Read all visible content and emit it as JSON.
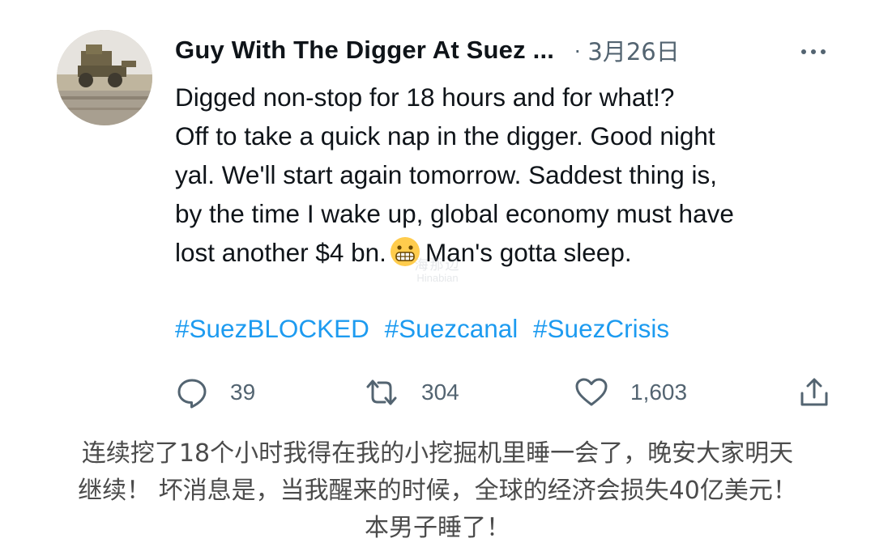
{
  "tweet": {
    "author_name": "Guy With The Digger At Suez ...",
    "separator": "·",
    "date": "3月26日",
    "avatar_icon": "digger-avatar-icon",
    "more_icon": "more-options-icon",
    "body_lines": [
      "Digged non-stop for 18 hours and for what!?",
      "Off to take a quick nap in the digger. Good night",
      "yal. We'll start again tomorrow. Saddest thing is,",
      "by the time I wake up, global economy must have",
      "lost another $4 bn."
    ],
    "emoji_icon": "grimacing-face-emoji",
    "body_tail": "Man's gotta sleep.",
    "hashtags": [
      "#SuezBLOCKED",
      "#Suezcanal",
      "#SuezCrisis"
    ],
    "hashtag_color": "#1d9bf0",
    "actions": {
      "reply": {
        "icon": "reply-icon",
        "count": "39"
      },
      "retweet": {
        "icon": "retweet-icon",
        "count": "304"
      },
      "like": {
        "icon": "heart-icon",
        "count": "1,603"
      },
      "share": {
        "icon": "share-icon"
      }
    }
  },
  "watermark": {
    "cn": "海那边",
    "en": "Hinabian"
  },
  "caption_lines": [
    "连续挖了18个小时我得在我的小挖掘机里睡一会了，晚安大家明天",
    "继续！ 坏消息是，当我醒来的时候，全球的经济会损失40亿美元！",
    "本男子睡了！"
  ]
}
